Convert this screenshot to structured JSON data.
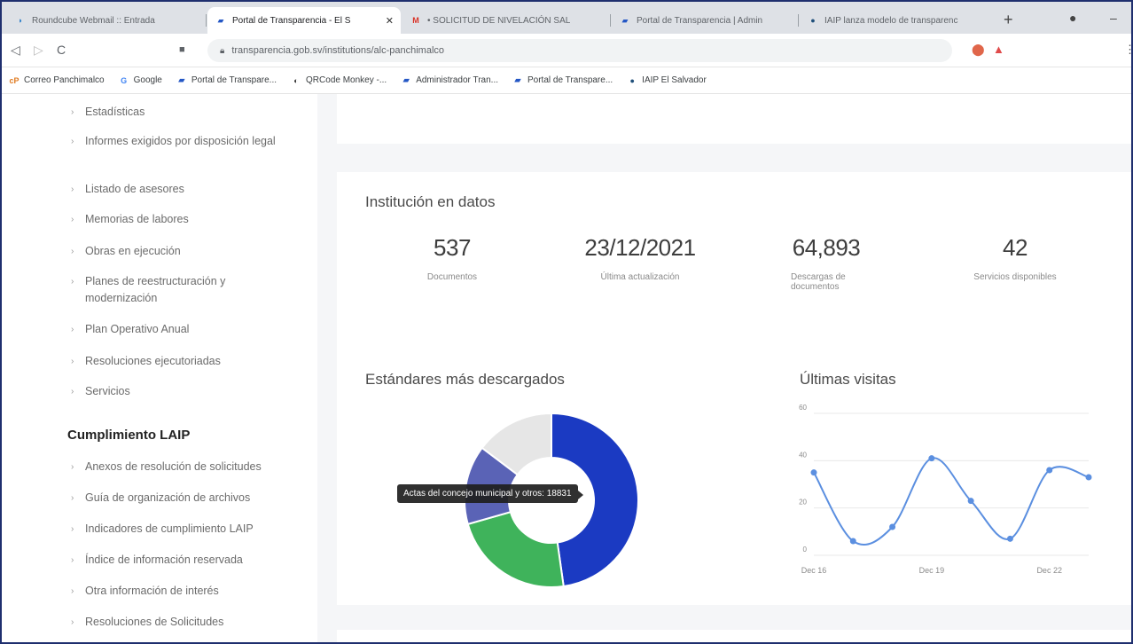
{
  "browser": {
    "tabs": [
      {
        "label": "Roundcube Webmail :: Entrada",
        "icon": "roundcube-icon",
        "active": false
      },
      {
        "label": "Portal de Transparencia - El S",
        "icon": "portal-icon",
        "active": true
      },
      {
        "label": "• SOLICITUD DE NIVELACIÓN SAL",
        "icon": "gmail-icon",
        "active": false
      },
      {
        "label": "Portal de Transparencia | Admin",
        "icon": "portal-icon",
        "active": false
      },
      {
        "label": "IAIP lanza modelo de transparenc",
        "icon": "iaip-icon",
        "active": false
      }
    ],
    "url": "transparencia.gob.sv/institutions/alc-panchimalco",
    "bookmarks": [
      {
        "label": "Correo Panchimalco",
        "icon": "correo-icon"
      },
      {
        "label": "Google",
        "icon": "google-icon"
      },
      {
        "label": "Portal de Transpare...",
        "icon": "portal-icon"
      },
      {
        "label": "QRCode Monkey -...",
        "icon": "qrcode-icon"
      },
      {
        "label": "Administrador Tran...",
        "icon": "portal-icon"
      },
      {
        "label": "Portal de Transpare...",
        "icon": "portal-icon"
      },
      {
        "label": "IAIP El Salvador",
        "icon": "iaip-icon"
      }
    ]
  },
  "sidebar": {
    "items_top": [
      {
        "label": "Estadísticas"
      },
      {
        "label": "Informes exigidos por disposición legal"
      },
      {
        "label": "Listado de asesores"
      },
      {
        "label": "Memorias de labores"
      },
      {
        "label": "Obras en ejecución"
      },
      {
        "label": "Planes de reestructuración y modernización"
      },
      {
        "label": "Plan Operativo Anual"
      },
      {
        "label": "Resoluciones ejecutoriadas"
      },
      {
        "label": "Servicios"
      }
    ],
    "section_title": "Cumplimiento LAIP",
    "items_laip": [
      {
        "label": "Anexos de resolución de solicitudes"
      },
      {
        "label": "Guía de organización de archivos"
      },
      {
        "label": "Indicadores de cumplimiento LAIP"
      },
      {
        "label": "Índice de información reservada"
      },
      {
        "label": "Otra información de interés"
      },
      {
        "label": "Resoluciones de Solicitudes"
      }
    ]
  },
  "main": {
    "title": "Institución en datos",
    "stats": [
      {
        "value": "537",
        "label": "Documentos"
      },
      {
        "value": "23/12/2021",
        "label": "Última actualización"
      },
      {
        "value": "64,893",
        "label": "Descargas de documentos"
      },
      {
        "value": "42",
        "label": "Servicios disponibles"
      }
    ],
    "donut_title": "Estándares más descargados",
    "tooltip": "Actas del concejo municipal y otros: 18831",
    "line_title": "Últimas visitas"
  },
  "chart_data": [
    {
      "type": "pie",
      "title": "Estándares más descargados",
      "categories": [
        "Actas del concejo municipal y otros",
        "",
        "",
        ""
      ],
      "values": [
        18831,
        9000,
        5800,
        5800
      ],
      "colors": [
        "#1b3ac2",
        "#3fb35b",
        "#5a63b6",
        "#e6e6e6"
      ]
    },
    {
      "type": "line",
      "title": "Últimas visitas",
      "x": [
        "Dec 16",
        "Dec 17",
        "Dec 18",
        "Dec 19",
        "Dec 20",
        "Dec 21",
        "Dec 22",
        "Dec 23"
      ],
      "x_ticks": [
        "Dec 16",
        "Dec 19",
        "Dec 22"
      ],
      "values": [
        35,
        6,
        12,
        41,
        23,
        7,
        36,
        33
      ],
      "ylim": [
        0,
        60
      ],
      "y_ticks": [
        0,
        20,
        40,
        60
      ],
      "color": "#5b8fe0",
      "grid": true
    }
  ]
}
